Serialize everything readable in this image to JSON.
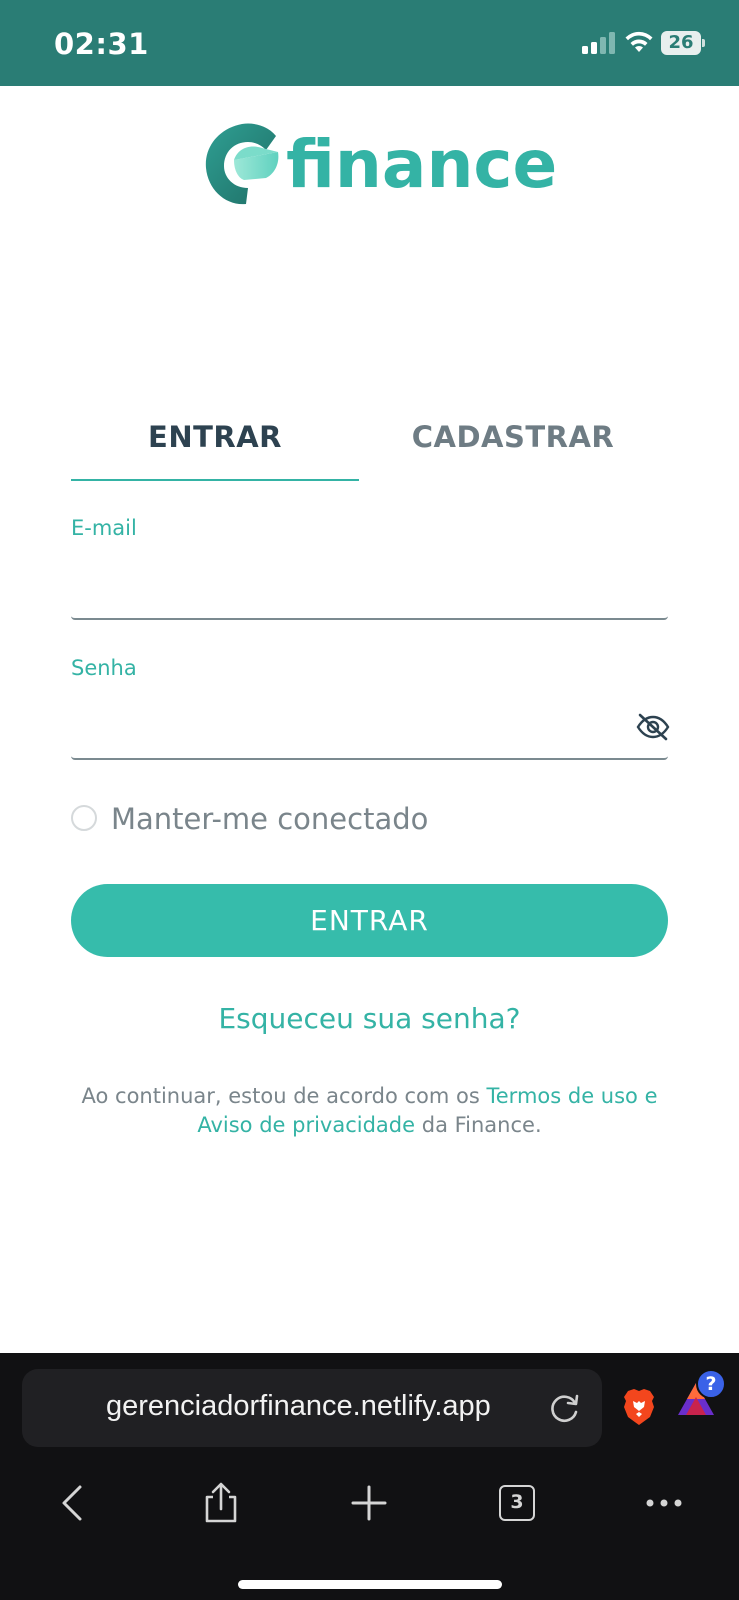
{
  "status_bar": {
    "time": "02:31",
    "battery": "26",
    "icons": [
      "signal-icon",
      "wifi-icon",
      "battery-icon"
    ]
  },
  "brand": {
    "name": "finance",
    "color": "#34b3a5",
    "header_color": "#2a7d75"
  },
  "tabs": {
    "login": "ENTRAR",
    "signup": "CADASTRAR"
  },
  "form": {
    "email_label": "E-mail",
    "email_value": "",
    "password_label": "Senha",
    "password_value": "",
    "remember_label": "Manter-me conectado",
    "remember_checked": false,
    "submit_label": "ENTRAR",
    "forgot_label": "Esqueceu sua senha?"
  },
  "terms": {
    "prefix": "Ao continuar, estou de acordo com os ",
    "link": "Termos de uso e Aviso de privacidade",
    "suffix": " da Finance."
  },
  "browser": {
    "url": "gerenciadorfinance.netlify.app",
    "tab_count": "3",
    "rewards_badge": "?"
  }
}
